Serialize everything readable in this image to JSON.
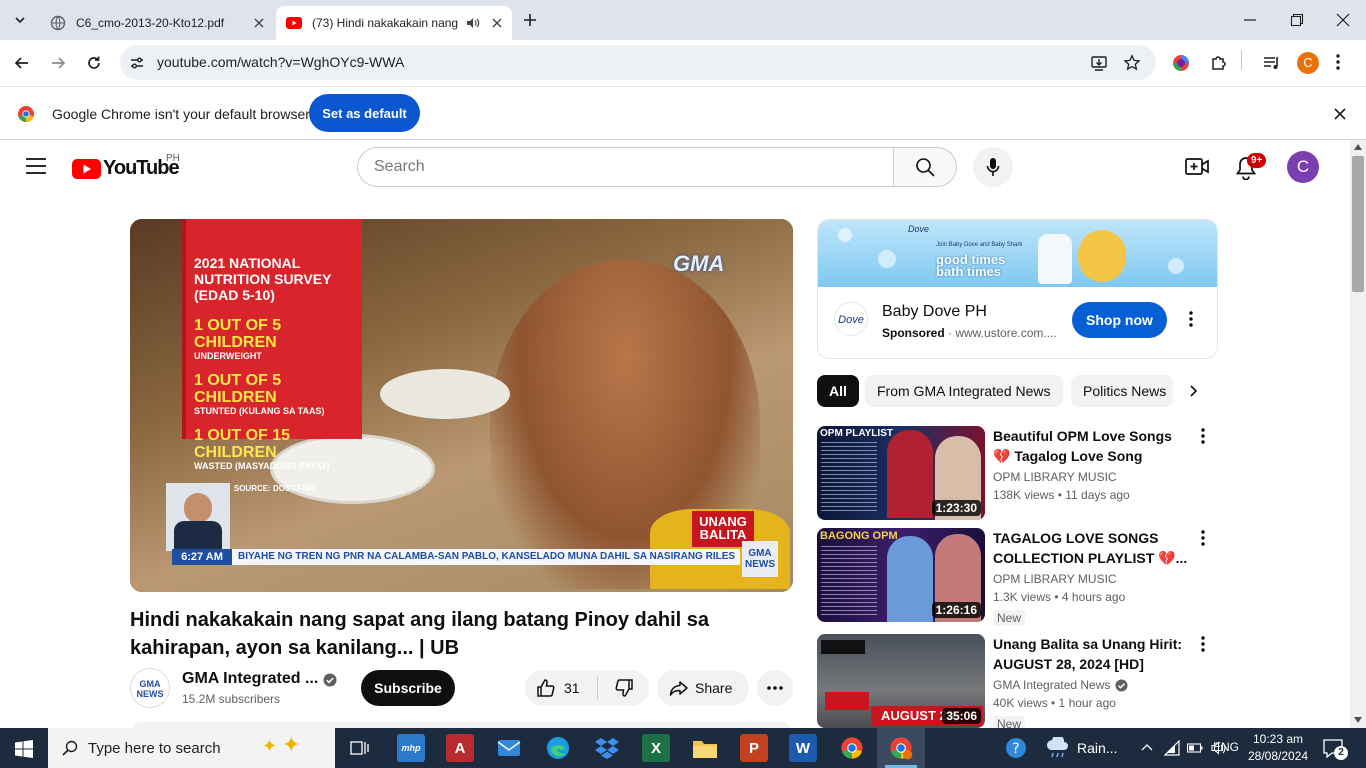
{
  "browser": {
    "tabs": [
      {
        "title": "C6_cmo-2013-20-Kto12.pdf",
        "active": false
      },
      {
        "title": "(73) Hindi nakakakain nang",
        "active": true
      }
    ],
    "url": "youtube.com/watch?v=WghOYc9-WWA",
    "profile_initial": "C",
    "infobar": {
      "message": "Google Chrome isn't your default browser",
      "button": "Set as default"
    }
  },
  "youtube": {
    "logo_text": "YouTube",
    "region": "PH",
    "search_placeholder": "Search",
    "notif_badge": "9+",
    "avatar_initial": "C",
    "video": {
      "overlay": {
        "survey_title": "2021 NATIONAL NUTRITION SURVEY (EDAD 5-10)",
        "stats": [
          {
            "big": "1 OUT OF 5 CHILDREN",
            "small": "UNDERWEIGHT"
          },
          {
            "big": "1 OUT OF 5 CHILDREN",
            "small": "STUNTED (KULANG SA TAAS)"
          },
          {
            "big": "1 OUT OF 15 CHILDREN",
            "small": "WASTED (MASYADONG PAYAT)"
          }
        ],
        "source": "SOURCE: DOST-FNRI",
        "network": "GMA",
        "show_line1": "UNANG",
        "show_line2": "BALITA",
        "time": "6:27 AM",
        "ticker": "BIYAHE NG TREN NG PNR NA CALAMBA-SAN PABLO, KANSELADO MUNA DAHIL SA NASIRANG RILES",
        "corner_logo_line1": "GMA",
        "corner_logo_line2": "NEWS"
      },
      "title": "Hindi nakakakain nang sapat ang ilang batang Pinoy dahil sa kahirapan, ayon sa kanilang... | UB",
      "channel": "GMA Integrated ...",
      "subscribers": "15.2M subscribers",
      "subscribe_label": "Subscribe",
      "likes": "31",
      "share_label": "Share",
      "avatar_line1": "GMA",
      "avatar_line2": "NEWS"
    },
    "ad": {
      "banner_text1": "Join Baby Dove and Baby Shark",
      "banner_text2": "good times",
      "banner_text3": "bath times",
      "brand": "Baby Dove PH",
      "sponsored": "Sponsored",
      "domain": "· www.ustore.com....",
      "cta": "Shop now",
      "logo_text": "Dove"
    },
    "chips": [
      "All",
      "From GMA Integrated News",
      "Politics News"
    ],
    "recommendations": [
      {
        "title": "Beautiful OPM Love Songs 💔 Tagalog Love Song Collection...",
        "channel": "OPM LIBRARY MUSIC",
        "meta": "138K views  • 11 days ago",
        "duration": "1:23:30",
        "badge": "",
        "thumb_label": "OPM PLAYLIST",
        "verified": false
      },
      {
        "title": "TAGALOG LOVE SONGS COLLECTION PLAYLIST 💔...",
        "channel": "OPM LIBRARY MUSIC",
        "meta": "1.3K views  • 4 hours ago",
        "duration": "1:26:16",
        "badge": "New",
        "thumb_label": "BAGONG OPM",
        "verified": false
      },
      {
        "title": "Unang Balita sa Unang Hirit: AUGUST 28, 2024 [HD]",
        "channel": "GMA Integrated News",
        "meta": "40K views  • 1 hour ago",
        "duration": "35:06",
        "badge": "New",
        "thumb_label": "AUGUST 28,",
        "verified": true
      }
    ]
  },
  "taskbar": {
    "search_placeholder": "Type here to search",
    "weather": "Rain...",
    "language": "ENG",
    "time": "10:23 am",
    "date": "28/08/2024",
    "notifications": "2",
    "apps": [
      "mhp",
      "A",
      "mail",
      "edge",
      "dropbox",
      "X",
      "folder",
      "P",
      "W",
      "chrome",
      "chrome-profile"
    ]
  },
  "colors": {
    "yt_red": "#ff0000",
    "accent_blue": "#0b57d0",
    "taskbar": "#1c2b3d",
    "gma_red": "#e3262d"
  }
}
